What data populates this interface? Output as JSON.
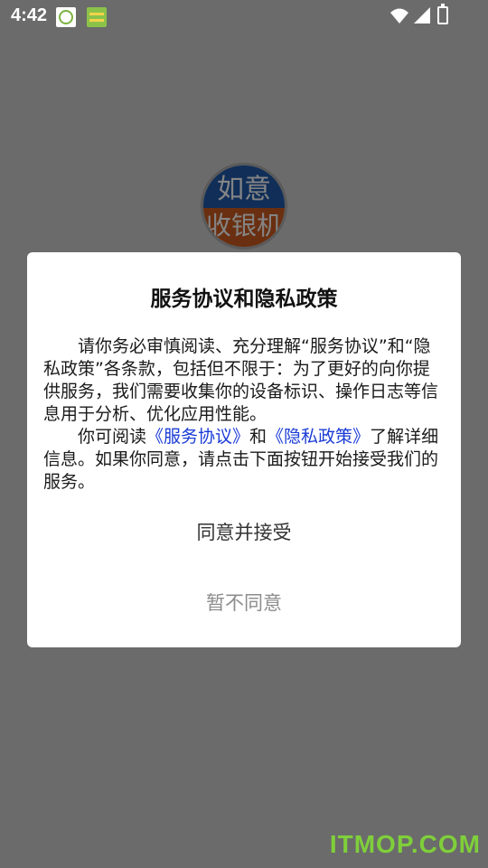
{
  "status_bar": {
    "time": "4:42",
    "app_icon_1": "yk-app-icon",
    "app_icon_2": "green-app-icon",
    "wifi_icon": "wifi-icon",
    "signal_icon": "cellular-signal-icon",
    "battery_icon": "battery-charging-icon"
  },
  "logo": {
    "line1": "如意",
    "line2": "收银机"
  },
  "dialog": {
    "title": "服务协议和隐私政策",
    "para1": "请你务必审慎阅读、充分理解“服务协议”和“隐私政策”各条款，包括但不限于：为了更好的向你提供服务，我们需要收集你的设备标识、操作日志等信息用于分析、优化应用性能。",
    "para2_prefix": "你可阅读",
    "link_service": "《服务协议》",
    "para2_and": "和",
    "link_privacy": "《隐私政策》",
    "para2_suffix": "了解详细信息。如果你同意，请点击下面按钮开始接受我们的服务。",
    "agree_label": "同意并接受",
    "decline_label": "暂不同意"
  },
  "watermark": "ITMOP.COM",
  "colors": {
    "overlay": "#6b6b6b",
    "link": "#1a3bd6",
    "decline": "#8c8c8c",
    "watermark": "#7fcf3a"
  }
}
